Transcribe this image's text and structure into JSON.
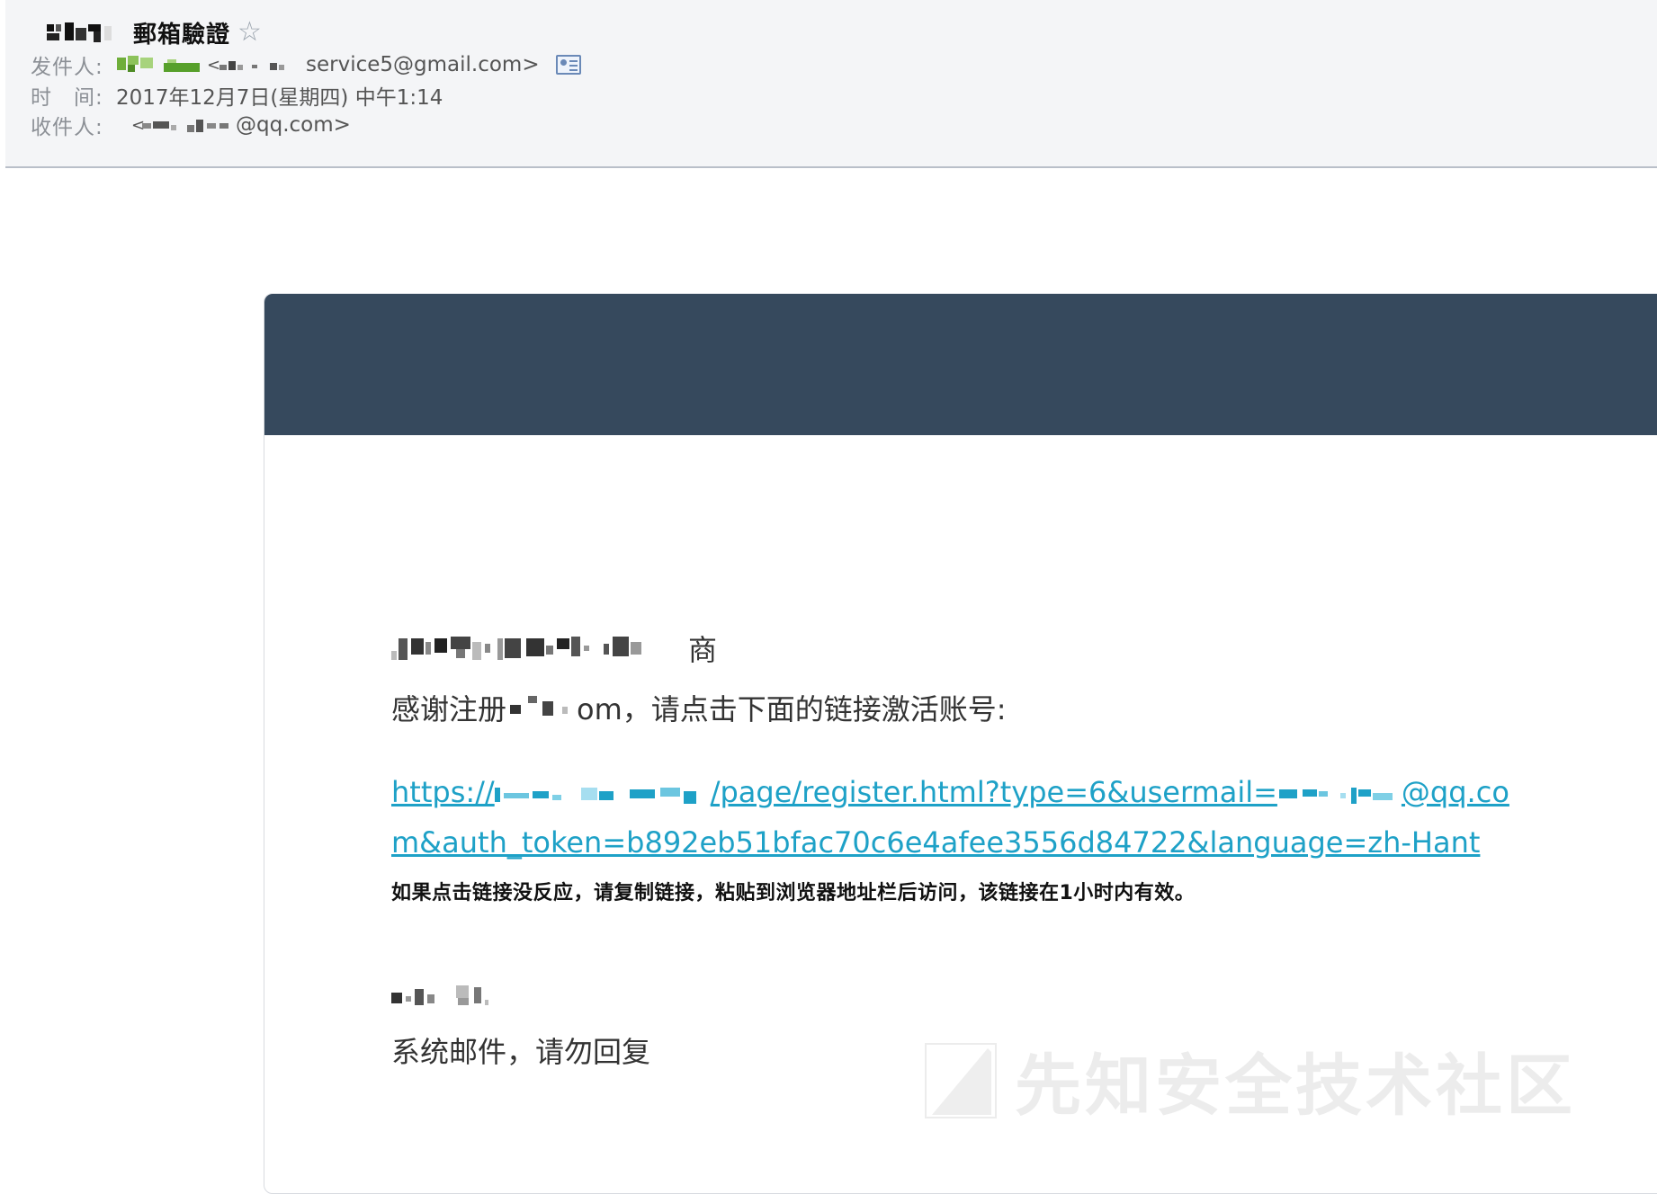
{
  "header": {
    "subject": "郵箱驗證",
    "sender_label": "发件人:",
    "sender_email": "service5@gmail.com>",
    "time_label": "时　间:",
    "time_value": "2017年12月7日(星期四) 中午1:14",
    "recipient_label": "收件人:",
    "recipient_value": "@qq.com>"
  },
  "email": {
    "greeting_suffix": "商",
    "thanks_prefix": "感谢注册",
    "thanks_suffix": "om，请点击下面的链接激活账号:",
    "link_prefix": "https://",
    "link_part2": "/page/register.html?type=6&usermail=",
    "link_part3": "@qq.com&auth_token=b892eb51bfac70c6e4afee3556d84722&language=zh-Hant",
    "hint": "如果点击链接没反应，请复制链接，粘贴到浏览器地址栏后访问，该链接在1小时内有效。",
    "system_note": "系统邮件，请勿回复"
  },
  "watermark": {
    "text": "先知安全技术社区"
  },
  "colors": {
    "banner": "#36495d",
    "link": "#1ea1c7",
    "header_bg": "#f4f5f7"
  },
  "icons": [
    "star-icon",
    "contact-card-icon",
    "watermark-logo-icon"
  ]
}
